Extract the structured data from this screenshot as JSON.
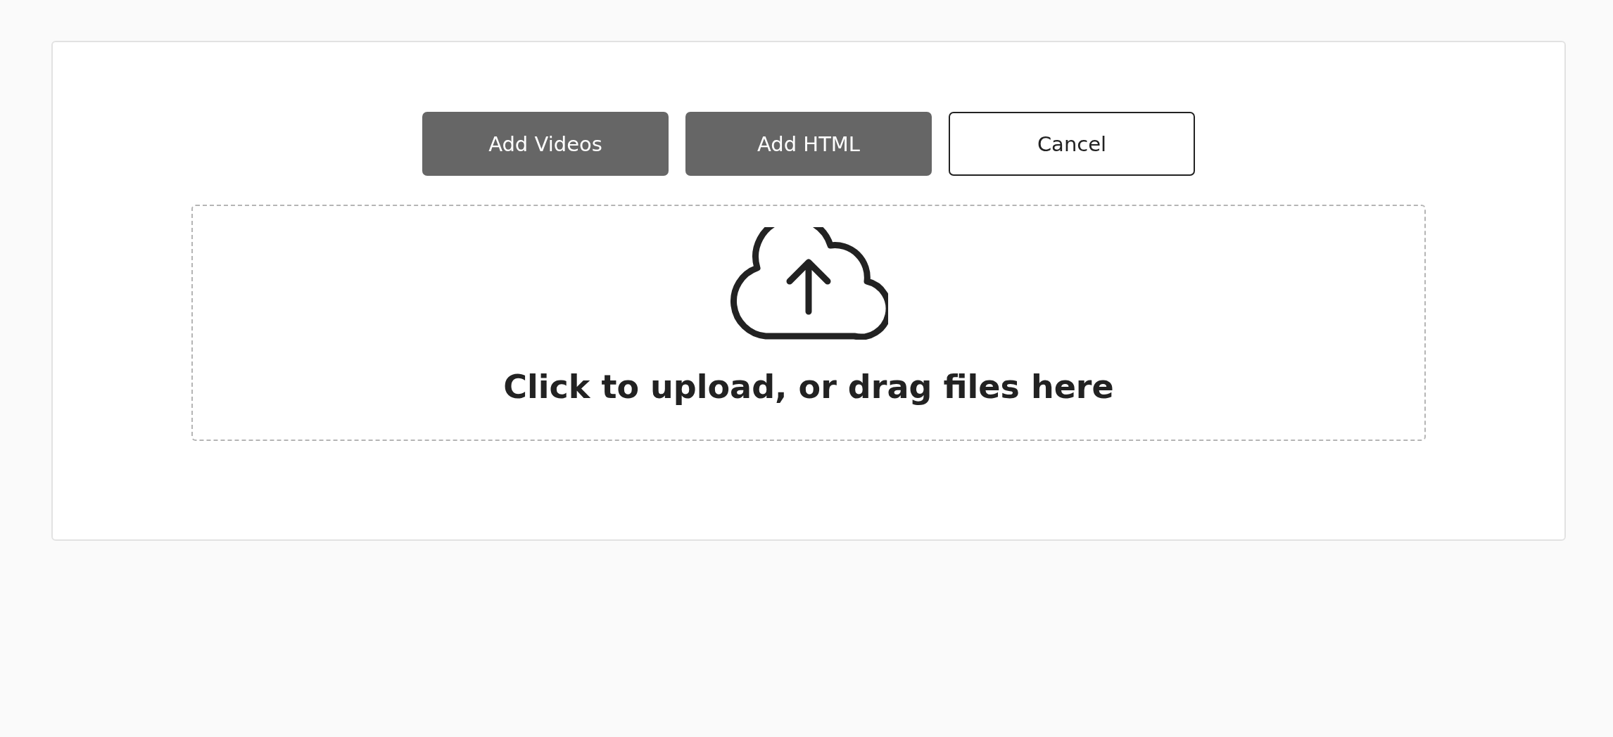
{
  "buttons": [
    {
      "label": "Add Videos",
      "kind": "filled"
    },
    {
      "label": "Add HTML",
      "kind": "filled"
    },
    {
      "label": "Cancel",
      "kind": "outline"
    }
  ],
  "dropzone": {
    "text": "Click to upload, or drag files here"
  }
}
